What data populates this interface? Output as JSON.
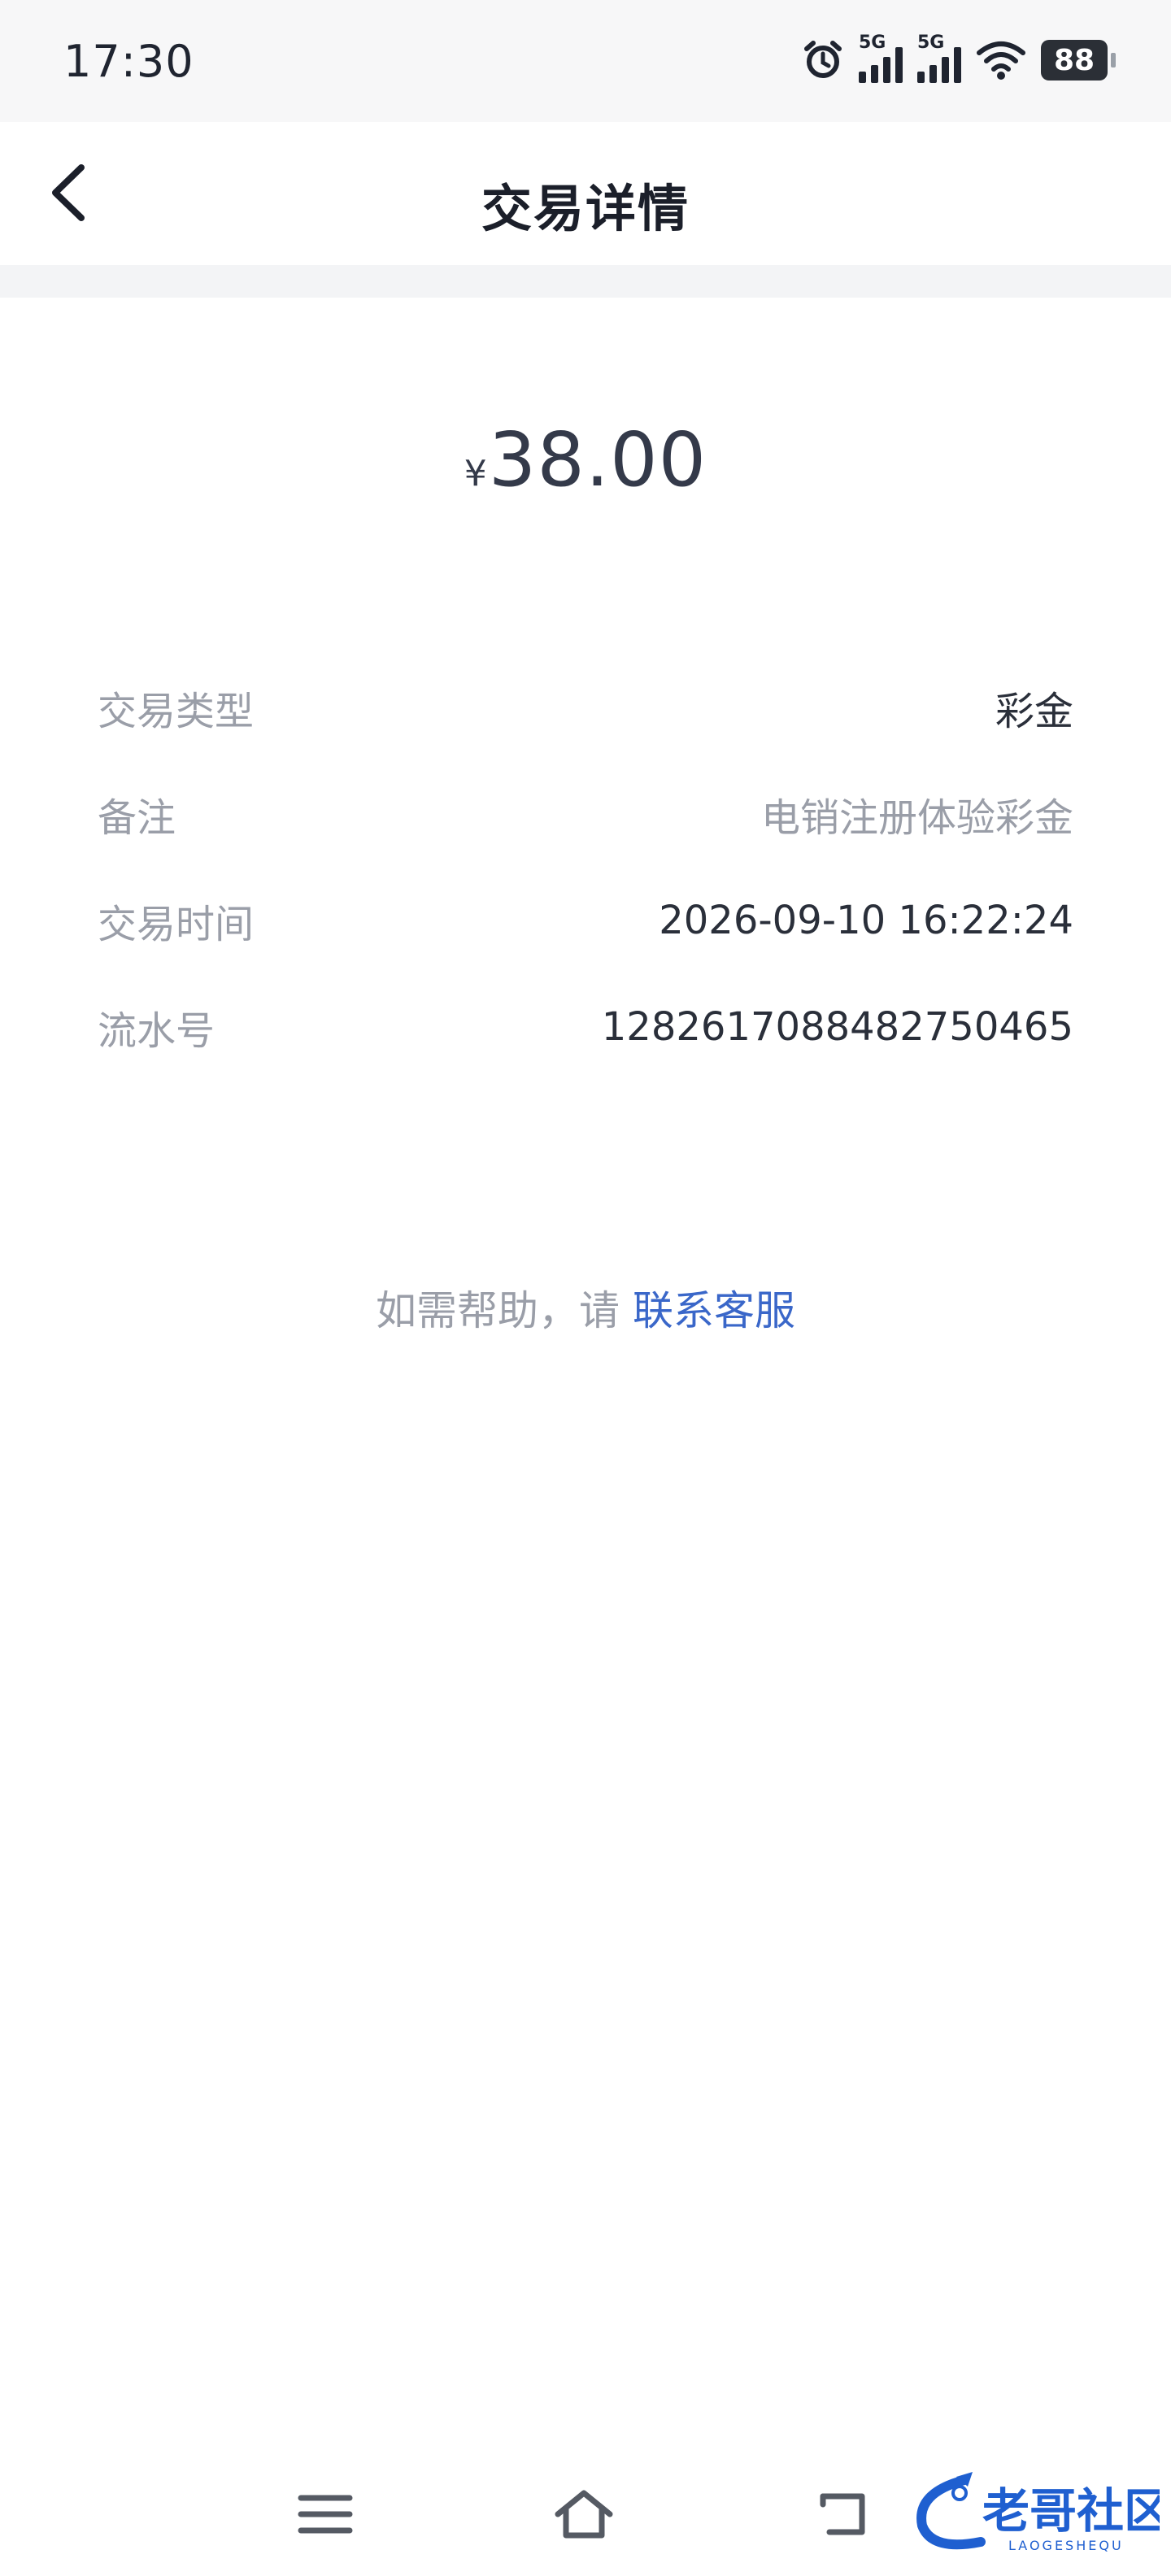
{
  "status_bar": {
    "time": "17:30",
    "signal_1": "5G",
    "signal_2": "5G",
    "battery": "88"
  },
  "header": {
    "title": "交易详情"
  },
  "amount": {
    "currency": "¥",
    "value": "38.00"
  },
  "details": [
    {
      "label": "交易类型",
      "value": "彩金"
    },
    {
      "label": "备注",
      "value": "电销注册体验彩金"
    },
    {
      "label": "交易时间",
      "value": "2026-09-10 16:22:24"
    },
    {
      "label": "流水号",
      "value": "1282617088482750465"
    }
  ],
  "help": {
    "prefix": "如需帮助，请 ",
    "link": "联系客服"
  },
  "watermark": {
    "text": "老哥社区",
    "sub": "LAOGESHEQU"
  }
}
